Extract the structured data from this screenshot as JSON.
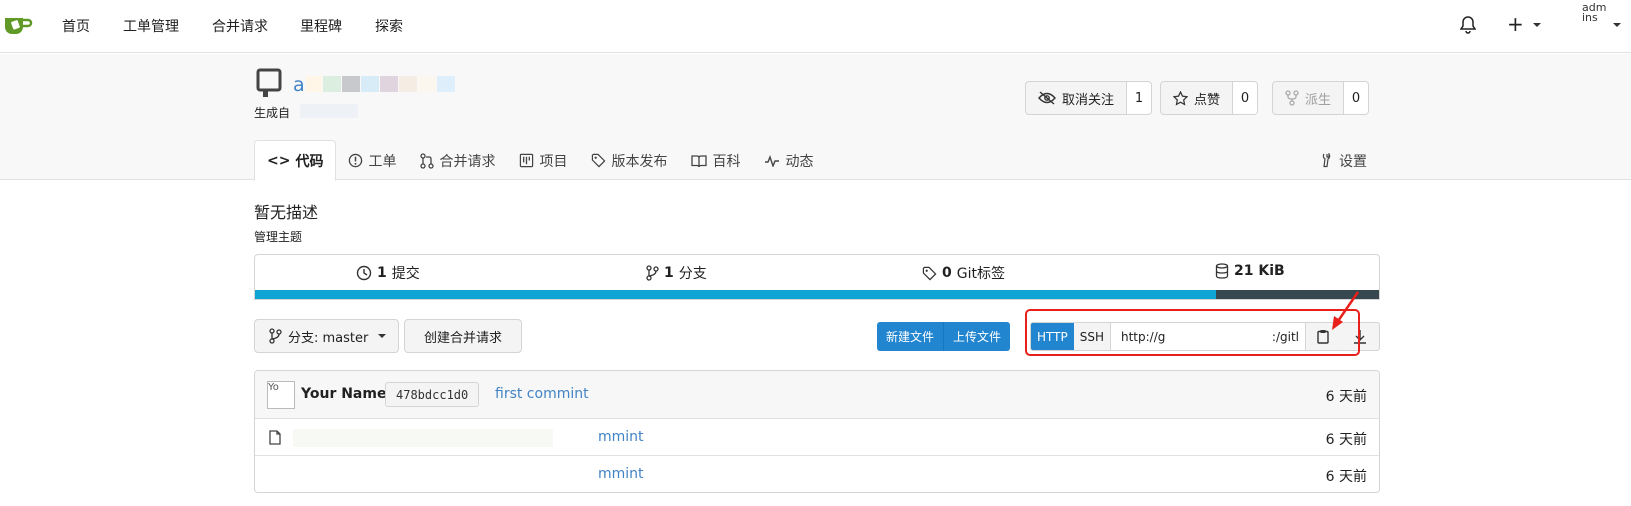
{
  "nav": {
    "items": [
      "首页",
      "工单管理",
      "合并请求",
      "里程碑",
      "探索"
    ],
    "plus": "+",
    "avatar_alt": "admins"
  },
  "repo": {
    "name_visible": "a",
    "generated_from": "生成自",
    "watch": {
      "label": "取消关注",
      "count": "1"
    },
    "star": {
      "label": "点赞",
      "count": "0"
    },
    "fork": {
      "label": "派生",
      "count": "0"
    }
  },
  "tabs": [
    {
      "label": "代码",
      "icon": "code-icon"
    },
    {
      "label": "工单",
      "icon": "issue-icon"
    },
    {
      "label": "合并请求",
      "icon": "pull-request-icon"
    },
    {
      "label": "项目",
      "icon": "project-icon"
    },
    {
      "label": "版本发布",
      "icon": "tag-icon"
    },
    {
      "label": "百科",
      "icon": "book-icon"
    },
    {
      "label": "动态",
      "icon": "pulse-icon"
    }
  ],
  "settings_tab": "设置",
  "description": "暂无描述",
  "topics_link": "管理主题",
  "stats": {
    "commits": {
      "num": "1",
      "label": "提交"
    },
    "branches": {
      "num": "1",
      "label": "分支"
    },
    "tags": {
      "num": "0",
      "label": "Git标签"
    },
    "size": "21 KiB"
  },
  "languages": [
    {
      "share": 85.5,
      "color": "#0ea5d4"
    },
    {
      "share": 14.5,
      "color": "#37474f"
    }
  ],
  "branch": {
    "label": "分支: master"
  },
  "create_pr": "创建合并请求",
  "new_file": "新建文件",
  "upload_file": "上传文件",
  "clone": {
    "http": "HTTP",
    "ssh": "SSH",
    "url_start": "http://g",
    "url_end": ":/gitl"
  },
  "latest_commit": {
    "avatar_alt": "Yo",
    "author": "Your Name",
    "sha": "478bdcc1d0",
    "message": "first commint",
    "time": "6 天前"
  },
  "files": [
    {
      "message": "mmint",
      "time": "6 天前",
      "icon": "file-icon"
    },
    {
      "message": "mmint",
      "time": "6 天前",
      "icon": ""
    }
  ],
  "colors": {
    "accent": "#2185d0",
    "link": "#4183c4",
    "highlight": "#e8201b"
  }
}
